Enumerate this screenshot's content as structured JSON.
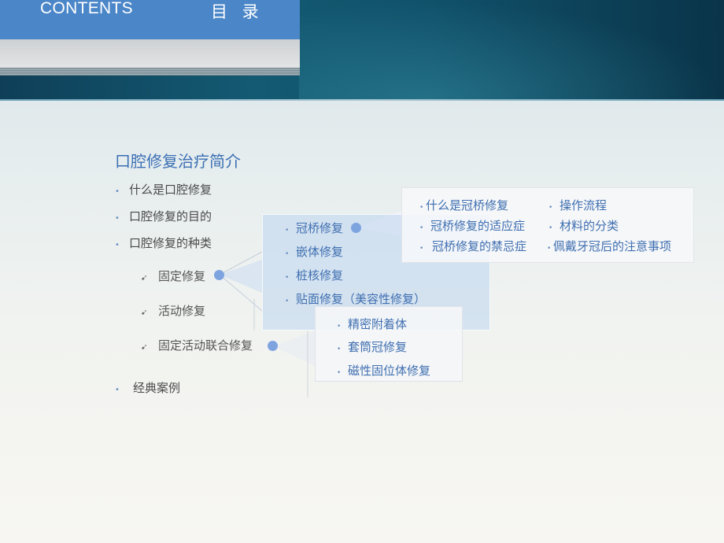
{
  "header": {
    "contents_en": "CONTENTS",
    "contents_zh": "目 录"
  },
  "section": {
    "title": "口腔修复治疗简介",
    "bullets": [
      "什么是口腔修复",
      "口腔修复的目的",
      "口腔修复的种类"
    ],
    "sub_items": [
      "固定修复",
      "活动修复",
      "固定活动联合修复"
    ],
    "last_bullet": "经典案例"
  },
  "fixed_box": {
    "items": [
      "冠桥修复",
      "嵌体修复",
      "桩核修复",
      "贴面修复（美容性修复）"
    ]
  },
  "crown_box": {
    "left": [
      "什么是冠桥修复",
      "冠桥修复的适应症",
      "冠桥修复的禁忌症"
    ],
    "right": [
      "操作流程",
      "材料的分类",
      "佩戴牙冠后的注意事项"
    ]
  },
  "combined_box": {
    "items": [
      "精密附着体",
      "套筒冠修复",
      "磁性固位体修复"
    ]
  },
  "colors": {
    "banner": "#135a72",
    "tab_blue": "#4a86c8",
    "accent_blue": "#3f6fb0",
    "node_blue": "#7ea4e0"
  },
  "icons": {
    "bullet": "small-dot-icon",
    "sub_bullet": "arrow-bullet-icon",
    "node": "circle-node-icon"
  }
}
